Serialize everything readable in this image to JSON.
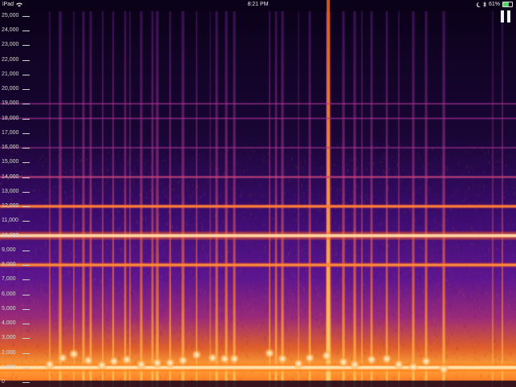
{
  "status_bar": {
    "device": "iPad",
    "time": "8:21 PM",
    "battery_percent": "61%",
    "battery_level": 0.61,
    "icons": [
      "wifi-icon",
      "moon-icon",
      "bluetooth-icon",
      "battery-icon"
    ]
  },
  "frequency_axis": {
    "unit": "Hz",
    "max": 26000,
    "labels": [
      "25,000",
      "24,000",
      "23,000",
      "22,000",
      "21,000",
      "20,000",
      "19,000",
      "18,000",
      "17,000",
      "16,000",
      "15,000",
      "14,000",
      "13,000",
      "12,000",
      "11,000",
      "10,000",
      "9,000",
      "8,000",
      "7,000",
      "6,000",
      "5,000",
      "4,000",
      "3,000",
      "2,000",
      "1,000",
      "0"
    ],
    "values": [
      25000,
      24000,
      23000,
      22000,
      21000,
      20000,
      19000,
      18000,
      17000,
      16000,
      15000,
      14000,
      13000,
      12000,
      11000,
      10000,
      9000,
      8000,
      7000,
      6000,
      5000,
      4000,
      3000,
      2000,
      1000,
      0
    ]
  },
  "spectrogram": {
    "colormap": [
      "#07010f",
      "#2a0a4a",
      "#5a1390",
      "#a8208f",
      "#e24a2a",
      "#ff8a1a",
      "#ffd27a",
      "#fff4e0"
    ],
    "tones_hz": [
      1000,
      8000,
      10000,
      12000,
      14000,
      16000,
      18000,
      19000
    ]
  },
  "controls": {
    "pause": "pause-icon"
  }
}
